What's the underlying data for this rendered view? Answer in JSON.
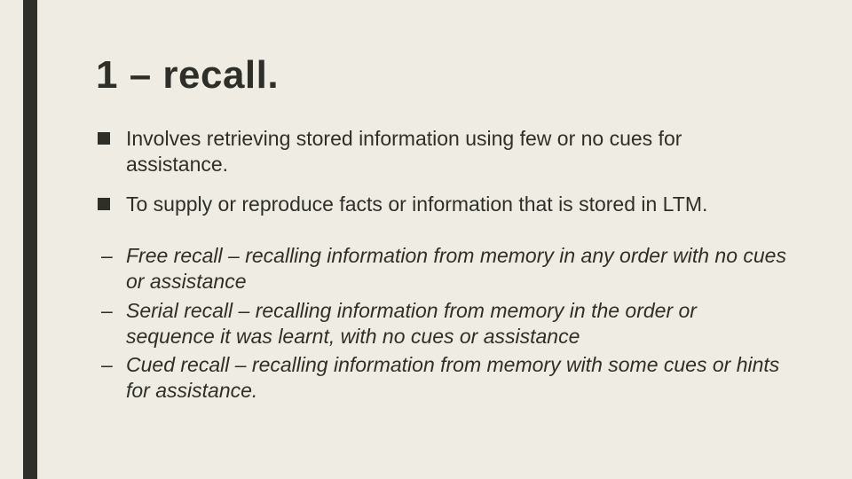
{
  "title": "1 – recall.",
  "bullets": {
    "a": "Involves retrieving stored information using few or no cues for assistance.",
    "b": "To supply or reproduce facts or information that is stored in LTM."
  },
  "subs": {
    "a": "Free recall – recalling information from memory in any order with no cues or assistance",
    "b": "Serial recall – recalling information from memory in the order or sequence it was learnt, with no cues or assistance",
    "c": "Cued recall – recalling information from memory with some cues or hints for assistance."
  }
}
